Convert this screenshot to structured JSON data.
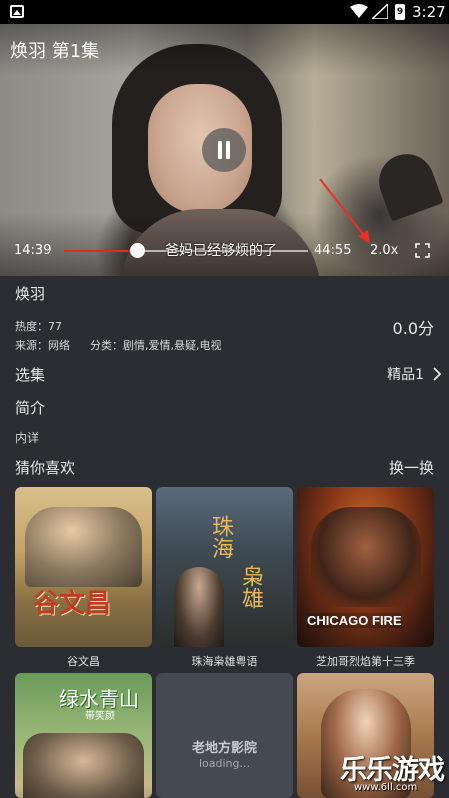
{
  "status_bar": {
    "time": "3:27",
    "battery_level": "9"
  },
  "player": {
    "title": "焕羽 第1集",
    "current_time": "14:39",
    "total_time": "44:55",
    "progress": 0.3,
    "subtitle": "爸妈已经够烦的了",
    "speed": "2.0x",
    "playing": true
  },
  "info": {
    "title": "焕羽",
    "heat": "热度：77",
    "score": "0.0分",
    "source": "来源：网络",
    "category": "分类：剧情,爱情,悬疑,电视"
  },
  "episodes": {
    "label": "选集",
    "value": "精品1"
  },
  "intro": {
    "label": "简介",
    "text": "内详"
  },
  "recommend": {
    "label": "猜你喜欢",
    "refresh": "换一换",
    "items": [
      {
        "title": "谷文昌",
        "poster_text": "谷文昌"
      },
      {
        "title": "珠海枭雄粤语",
        "poster_text_1": "珠海",
        "poster_text_2": "枭雄"
      },
      {
        "title": "芝加哥烈焰第十三季",
        "poster_text": "CHICAGO FIRE"
      },
      {
        "title": "",
        "poster_text": "绿水青山",
        "poster_sub": "带笑颜"
      },
      {
        "title": "",
        "poster_name": "老地方影院",
        "poster_loading": "loading..."
      },
      {
        "title": ""
      }
    ]
  },
  "watermark": {
    "text": "乐乐游戏",
    "url": "www.6ll.com"
  },
  "colors": {
    "background": "#2b2d33",
    "progress_fill": "#e5252a",
    "arrow": "#e8302a"
  }
}
